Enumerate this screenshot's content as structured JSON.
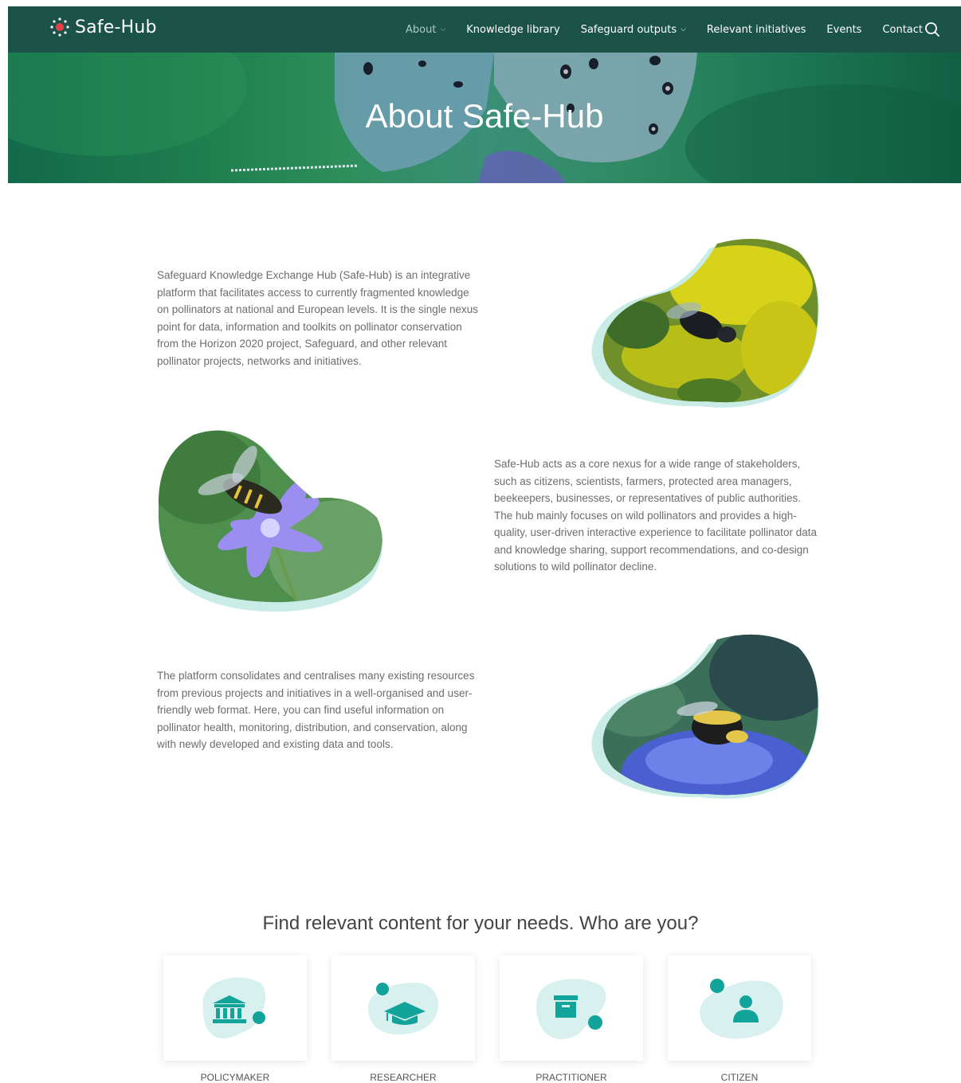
{
  "header": {
    "logo_text": "Safe-Hub",
    "nav": [
      {
        "label": "About",
        "has_dropdown": true,
        "active": true
      },
      {
        "label": "Knowledge library",
        "has_dropdown": false
      },
      {
        "label": "Safeguard outputs",
        "has_dropdown": true
      },
      {
        "label": "Relevant initiatives",
        "has_dropdown": false
      },
      {
        "label": "Events",
        "has_dropdown": false
      },
      {
        "label": "Contact",
        "has_dropdown": false
      }
    ],
    "search_icon": "search-icon"
  },
  "hero": {
    "title": "About Safe-Hub"
  },
  "content": {
    "paragraph1": "Safeguard Knowledge Exchange Hub (Safe-Hub) is an integrative platform that facilitates access to currently fragmented knowledge on pollinators at national and European levels. It is the single nexus point for data, information and toolkits on pollinator conservation from the Horizon 2020 project, Safeguard, and other relevant pollinator projects, networks and initiatives.",
    "paragraph2": "Safe-Hub acts as a core nexus for a wide range of stakeholders, such as citizens, scientists, farmers, protected area managers, beekeepers, businesses, or representatives of public authorities. The hub mainly focuses on wild pollinators and provides a high-quality, user-driven interactive experience to facilitate pollinator data and knowledge sharing, support recommendations, and co-design solutions to wild pollinator decline.",
    "paragraph3": "The platform consolidates and centralises many existing resources from previous projects and initiatives in a well-organised and user-friendly web format. Here, you can find useful information on pollinator health, monitoring, distribution, and conservation, along with newly developed and existing data and tools."
  },
  "audience": {
    "title": "Find relevant content for your needs. Who are you?",
    "cards": [
      {
        "label": "POLICYMAKER",
        "icon": "government-building-icon"
      },
      {
        "label": "RESEARCHER",
        "icon": "graduation-cap-icon"
      },
      {
        "label": "PRACTITIONER",
        "icon": "archive-box-icon"
      },
      {
        "label": "CITIZEN",
        "icon": "person-icon"
      }
    ]
  },
  "colors": {
    "header_bg": "#1c5348",
    "accent": "#12a39a",
    "blob_light": "#d9f1ee"
  }
}
